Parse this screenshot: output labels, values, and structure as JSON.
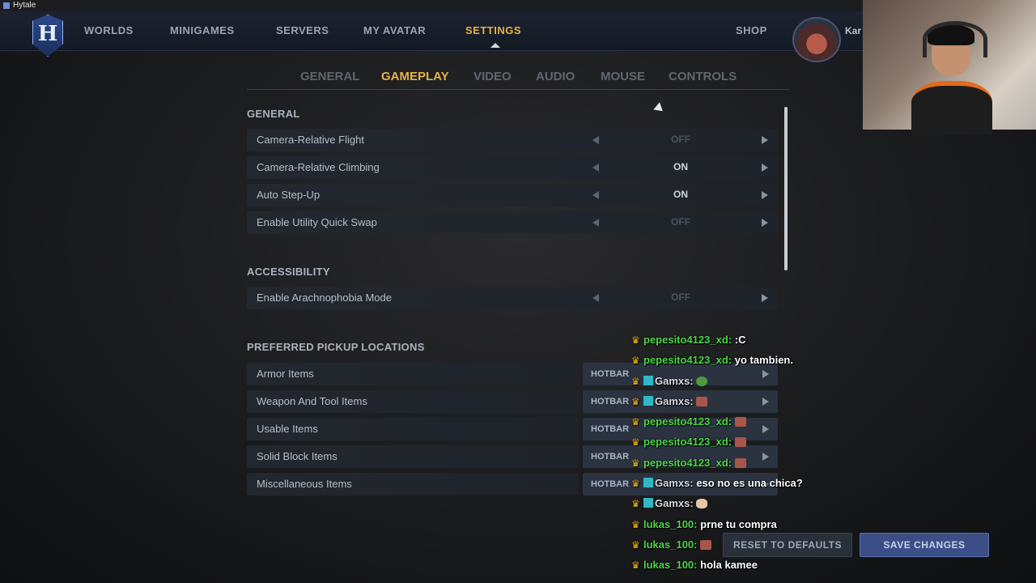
{
  "window": {
    "title": "Hytale"
  },
  "nav": {
    "logo": "H",
    "items": [
      "WORLDS",
      "MINIGAMES",
      "SERVERS",
      "MY AVATAR",
      "SETTINGS"
    ],
    "active": "SETTINGS",
    "shop": "SHOP",
    "username": "Kar"
  },
  "tabs": {
    "items": [
      "GENERAL",
      "GAMEPLAY",
      "VIDEO",
      "AUDIO",
      "MOUSE",
      "CONTROLS"
    ],
    "active": "GAMEPLAY"
  },
  "sections": {
    "general": {
      "title": "GENERAL",
      "rows": [
        {
          "label": "Camera-Relative Flight",
          "value": "OFF"
        },
        {
          "label": "Camera-Relative Climbing",
          "value": "ON"
        },
        {
          "label": "Auto Step-Up",
          "value": "ON"
        },
        {
          "label": "Enable Utility Quick Swap",
          "value": "OFF"
        }
      ]
    },
    "accessibility": {
      "title": "ACCESSIBILITY",
      "rows": [
        {
          "label": "Enable Arachnophobia Mode",
          "value": "OFF"
        }
      ]
    },
    "pickup": {
      "title": "PREFERRED PICKUP LOCATIONS",
      "rows": [
        {
          "label": "Armor Items",
          "value": "HOTBAR"
        },
        {
          "label": "Weapon And Tool Items",
          "value": "HOTBAR"
        },
        {
          "label": "Usable Items",
          "value": "HOTBAR"
        },
        {
          "label": "Solid Block Items",
          "value": "HOTBAR"
        },
        {
          "label": "Miscellaneous Items",
          "value": "HOTBAR"
        }
      ]
    }
  },
  "buttons": {
    "reset": "RESET TO DEFAULTS",
    "save": "SAVE CHANGES"
  },
  "chat": [
    {
      "user": "pepesito4123_xd:",
      "msg": ":C",
      "mod": false
    },
    {
      "user": "pepesito4123_xd:",
      "msg": "yo tambien.",
      "mod": false
    },
    {
      "user": "Gamxs:",
      "msg": "",
      "mod": true,
      "emote": "frog"
    },
    {
      "user": "Gamxs:",
      "msg": "",
      "mod": true,
      "emote": "face"
    },
    {
      "user": "pepesito4123_xd:",
      "msg": "",
      "mod": false,
      "emote": "face"
    },
    {
      "user": "pepesito4123_xd:",
      "msg": "",
      "mod": false,
      "emote": "face"
    },
    {
      "user": "pepesito4123_xd:",
      "msg": "",
      "mod": false,
      "emote": "face"
    },
    {
      "user": "Gamxs:",
      "msg": "eso no es una chica?",
      "mod": true
    },
    {
      "user": "Gamxs:",
      "msg": "",
      "mod": true,
      "emote": "hand"
    },
    {
      "user": "lukas_100:",
      "msg": "prne tu compra",
      "mod": false
    },
    {
      "user": "lukas_100:",
      "msg": "",
      "mod": false,
      "emote": "face"
    },
    {
      "user": "lukas_100:",
      "msg": "hola kamee",
      "mod": false
    }
  ]
}
